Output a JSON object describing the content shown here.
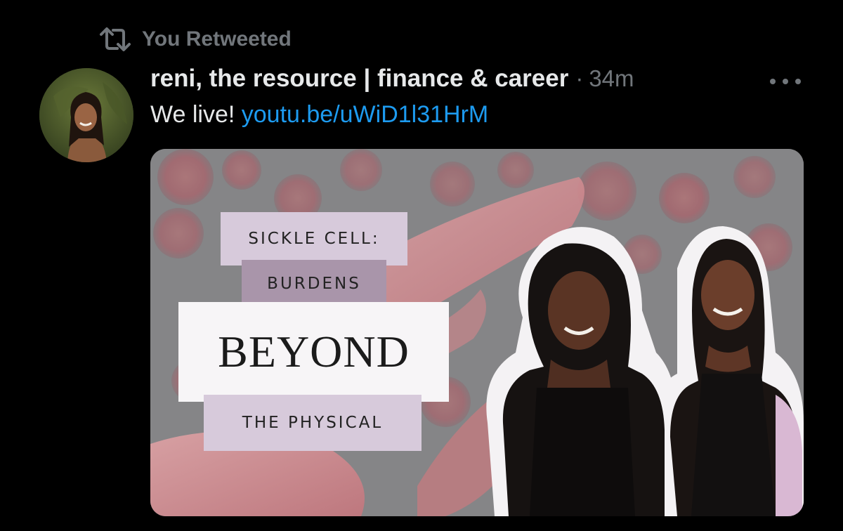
{
  "retweet_context": {
    "label": "You Retweeted",
    "icon": "retweet-icon"
  },
  "tweet": {
    "display_name": "reni, the resource | finance & career",
    "separator": "·",
    "timestamp": "34m",
    "text_prefix": "We live!",
    "link_text": "youtu.be/uWiD1l31HrM",
    "more_icon": "more-horizontal-icon"
  },
  "media": {
    "line1": "SICKLE CELL:",
    "line2": "BURDENS",
    "line3": "BEYOND",
    "line4": "THE PHYSICAL"
  },
  "colors": {
    "background": "#000000",
    "primary_text": "#e7e9ea",
    "secondary_text": "#71767b",
    "link": "#1d9bf0"
  }
}
